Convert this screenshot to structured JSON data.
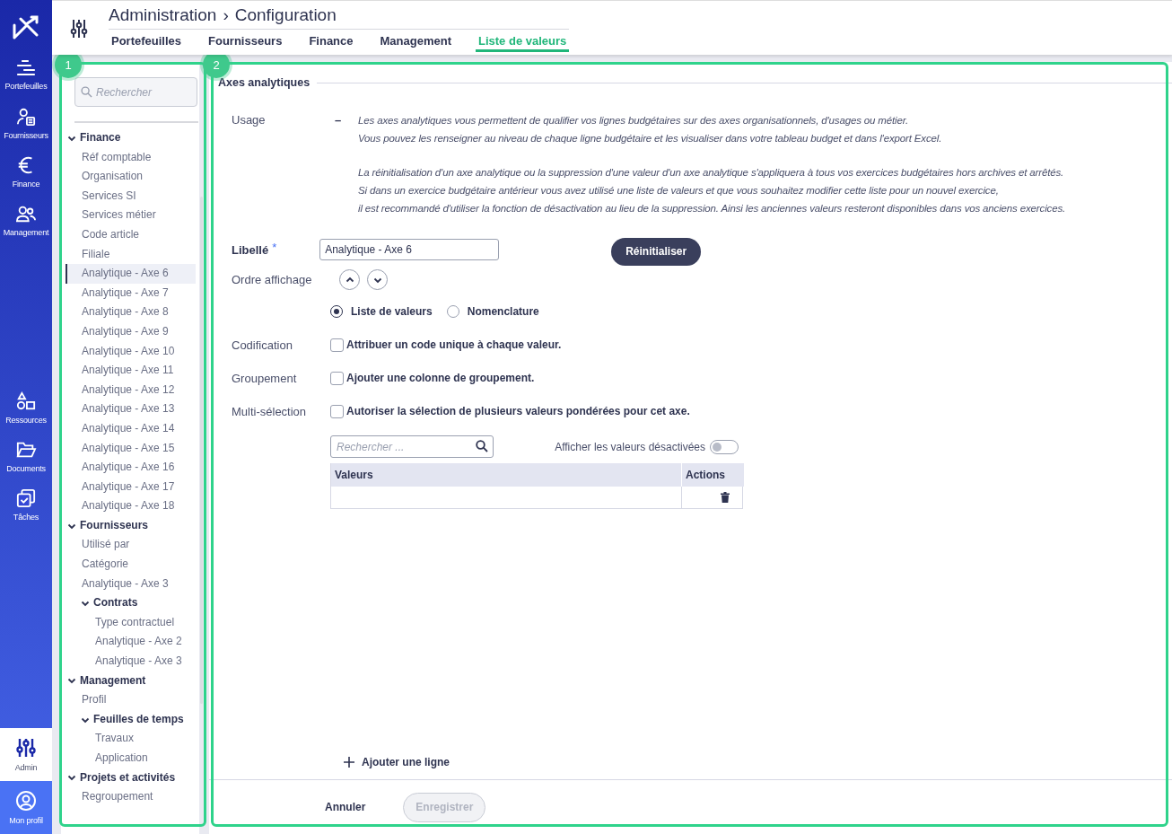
{
  "nav": {
    "main": [
      {
        "label": "Portefeuilles",
        "selected": false
      },
      {
        "label": "Fournisseurs",
        "selected": false
      },
      {
        "label": "Finance",
        "selected": false
      },
      {
        "label": "Management",
        "selected": false
      }
    ],
    "tools": [
      {
        "label": "Ressources",
        "selected": false
      },
      {
        "label": "Documents",
        "selected": false
      },
      {
        "label": "Tâches",
        "selected": false
      }
    ],
    "footer": [
      {
        "label": "Admin",
        "selected": true
      },
      {
        "label": "Mon profil",
        "selected": false
      }
    ]
  },
  "header": {
    "title": "Administration",
    "separator": "›",
    "subtitle": "Configuration",
    "tabs": [
      {
        "label": "Portefeuilles",
        "selected": false
      },
      {
        "label": "Fournisseurs",
        "selected": false
      },
      {
        "label": "Finance",
        "selected": false
      },
      {
        "label": "Management",
        "selected": false
      },
      {
        "label": "Liste de valeurs",
        "selected": true
      }
    ]
  },
  "annotations": [
    {
      "label": "1"
    },
    {
      "label": "2"
    }
  ],
  "tree": {
    "placeholder": "Rechercher",
    "groups": [
      {
        "label": "Finance",
        "expanded": true,
        "children": [
          {
            "label": "Réf comptable",
            "selected": false
          },
          {
            "label": "Organisation",
            "selected": false
          },
          {
            "label": "Services SI",
            "selected": false
          },
          {
            "label": "Services métier",
            "selected": false
          },
          {
            "label": "Code article",
            "selected": false
          },
          {
            "label": "Filiale",
            "selected": false
          },
          {
            "label": "Analytique - Axe 6",
            "selected": true
          },
          {
            "label": "Analytique - Axe 7",
            "selected": false
          },
          {
            "label": "Analytique - Axe 8",
            "selected": false
          },
          {
            "label": "Analytique - Axe 9",
            "selected": false
          },
          {
            "label": "Analytique - Axe 10",
            "selected": false
          },
          {
            "label": "Analytique - Axe 11",
            "selected": false
          },
          {
            "label": "Analytique - Axe 12",
            "selected": false
          },
          {
            "label": "Analytique - Axe 13",
            "selected": false
          },
          {
            "label": "Analytique - Axe 14",
            "selected": false
          },
          {
            "label": "Analytique - Axe 15",
            "selected": false
          },
          {
            "label": "Analytique - Axe 16",
            "selected": false
          },
          {
            "label": "Analytique - Axe 17",
            "selected": false
          },
          {
            "label": "Analytique - Axe 18",
            "selected": false
          }
        ]
      },
      {
        "label": "Fournisseurs",
        "expanded": true,
        "children": [
          {
            "label": "Utilisé par",
            "selected": false
          },
          {
            "label": "Catégorie",
            "selected": false
          },
          {
            "label": "Analytique - Axe 3",
            "selected": false
          },
          {
            "label": "Contrats",
            "expanded": true,
            "children": [
              {
                "label": "Type contractuel",
                "selected": false
              },
              {
                "label": "Analytique - Axe 2",
                "selected": false
              },
              {
                "label": "Analytique - Axe 3",
                "selected": false
              }
            ]
          }
        ]
      },
      {
        "label": "Management",
        "expanded": true,
        "children": [
          {
            "label": "Profil",
            "selected": false
          },
          {
            "label": "Feuilles de temps",
            "expanded": true,
            "children": [
              {
                "label": "Travaux",
                "selected": false
              },
              {
                "label": "Application",
                "selected": false
              }
            ]
          }
        ]
      },
      {
        "label": "Projets et activités",
        "expanded": true,
        "children": [
          {
            "label": "Regroupement",
            "selected": false
          }
        ]
      }
    ]
  },
  "panel": {
    "legend": "Axes analytiques",
    "usage": {
      "label": "Usage",
      "collapse": "–",
      "paragraphs": [
        [
          "Les axes analytiques vous permettent de qualifier vos lignes budgétaires sur des axes organisationnels, d'usages ou métier.",
          "Vous pouvez les renseigner au niveau de chaque ligne budgétaire et les visualiser dans votre tableau budget et dans l'export Excel."
        ],
        [
          "La réinitialisation d'un axe analytique ou la suppression d'une valeur d'un axe analytique s'appliquera à tous vos exercices budgétaires hors archives et arrêtés.",
          "Si dans un exercice budgétaire antérieur vous avez utilisé une liste de valeurs et que vous souhaitez modifier cette liste pour un nouvel exercice,",
          "il est recommandé d'utiliser la fonction de désactivation au lieu de la suppression. Ainsi les anciennes valeurs resteront disponibles dans vos anciens exercices."
        ]
      ]
    },
    "libelle": {
      "label": "Libellé",
      "required_mark": "*",
      "value": "Analytique - Axe 6"
    },
    "reset_button": "Réinitialiser",
    "order": {
      "label": "Ordre affichage"
    },
    "types": [
      {
        "label": "Liste de valeurs",
        "selected": true
      },
      {
        "label": "Nomenclature",
        "selected": false
      }
    ],
    "options": [
      {
        "label": "Codification",
        "text": "Attribuer un code unique à chaque valeur.",
        "checked": false
      },
      {
        "label": "Groupement",
        "text": "Ajouter une colonne de groupement.",
        "checked": false
      },
      {
        "label": "Multi-sélection",
        "text": "Autoriser la sélection de plusieurs valeurs pondérées pour cet axe.",
        "checked": false
      }
    ],
    "search": {
      "placeholder": "Rechercher ..."
    },
    "show_disabled": {
      "label": "Afficher les valeurs désactivées",
      "on": false
    },
    "table": {
      "columns": [
        "Valeurs",
        "Actions"
      ]
    },
    "add_line": "Ajouter une ligne",
    "cancel": "Annuler",
    "save": {
      "label": "Enregistrer",
      "disabled": true
    }
  }
}
